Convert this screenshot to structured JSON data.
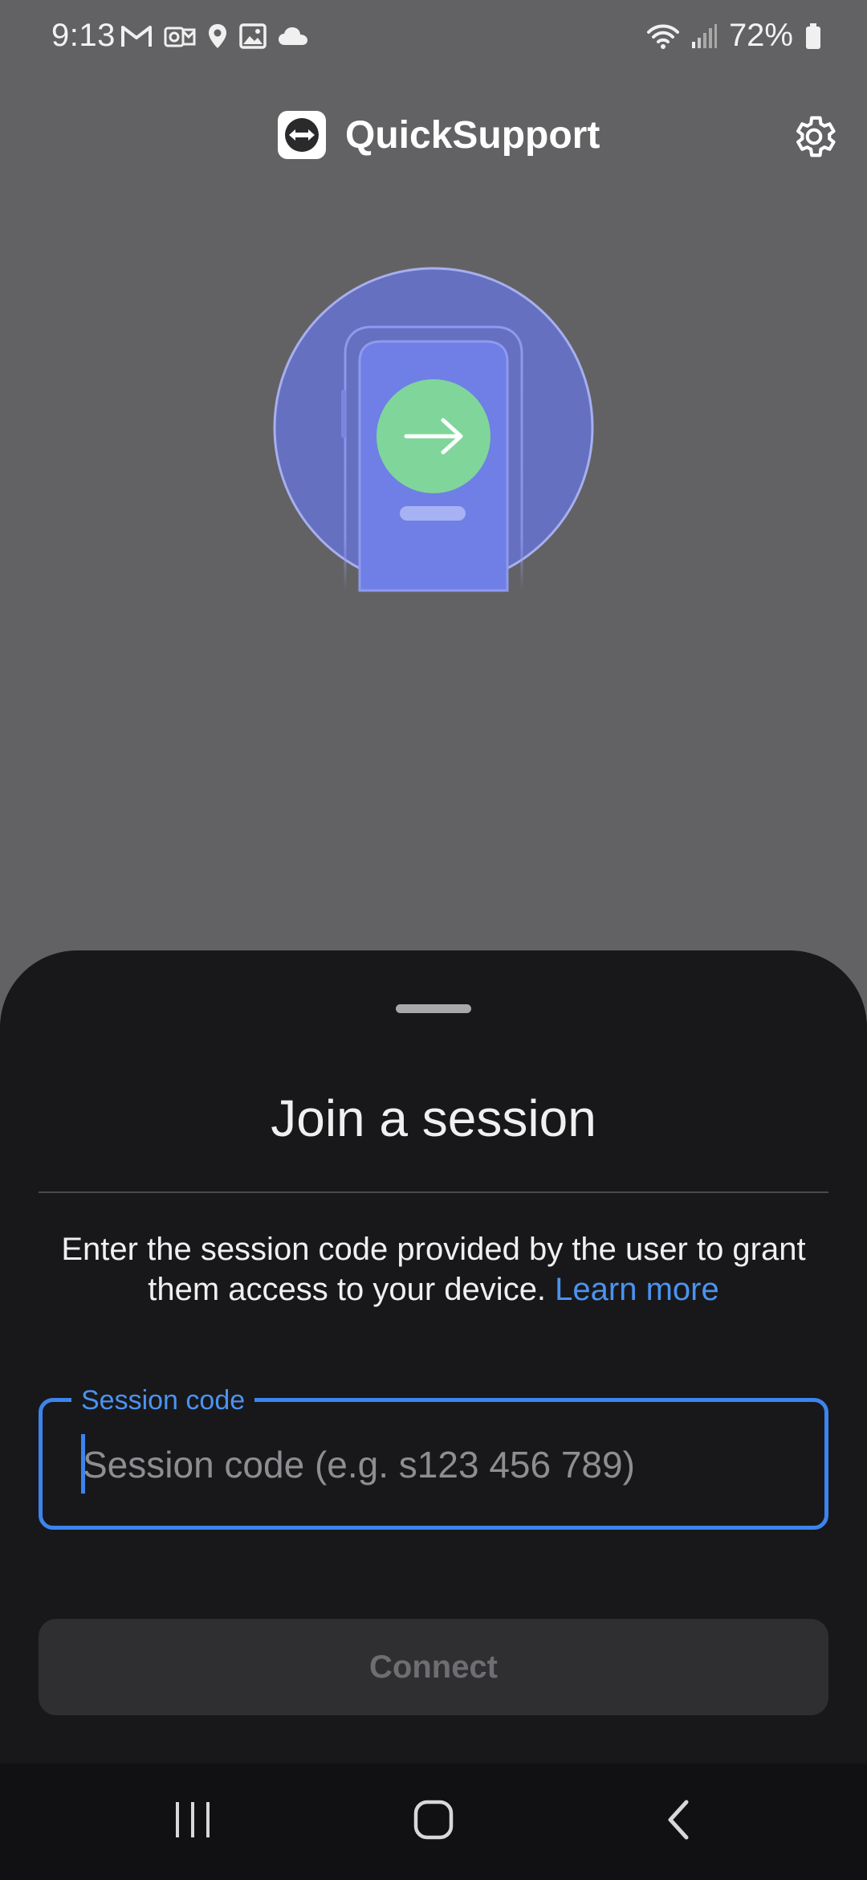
{
  "status_bar": {
    "time": "9:13",
    "icons": [
      "gmail-icon",
      "outlook-icon",
      "location-icon",
      "gallery-icon",
      "cloud-icon"
    ],
    "wifi_icon": "wifi-icon",
    "signal_icon": "signal-icon",
    "battery_percent": "72%",
    "battery_icon": "battery-icon"
  },
  "header": {
    "app_title": "QuickSupport",
    "logo_icon": "teamviewer-logo-icon",
    "settings_icon": "gear-icon"
  },
  "illustration": {
    "description_icon": "phone-connect-illustration",
    "arrow_icon": "arrow-right-icon"
  },
  "sheet": {
    "title": "Join a session",
    "description": "Enter the session code provided by the user to grant them access to your device.",
    "learn_more": "Learn more",
    "field_label": "Session code",
    "field_placeholder": "Session code (e.g. s123 456 789)",
    "field_value": "",
    "connect_label": "Connect"
  },
  "nav": {
    "recents_icon": "recents-icon",
    "home_icon": "home-icon",
    "back_icon": "back-icon"
  },
  "colors": {
    "background": "#626264",
    "sheet": "#18181a",
    "accent": "#3c84ef",
    "link": "#4b93f0",
    "illustration_circle": "#6670c0",
    "illustration_green": "#80d69a",
    "button_disabled": "#2f2f31"
  }
}
